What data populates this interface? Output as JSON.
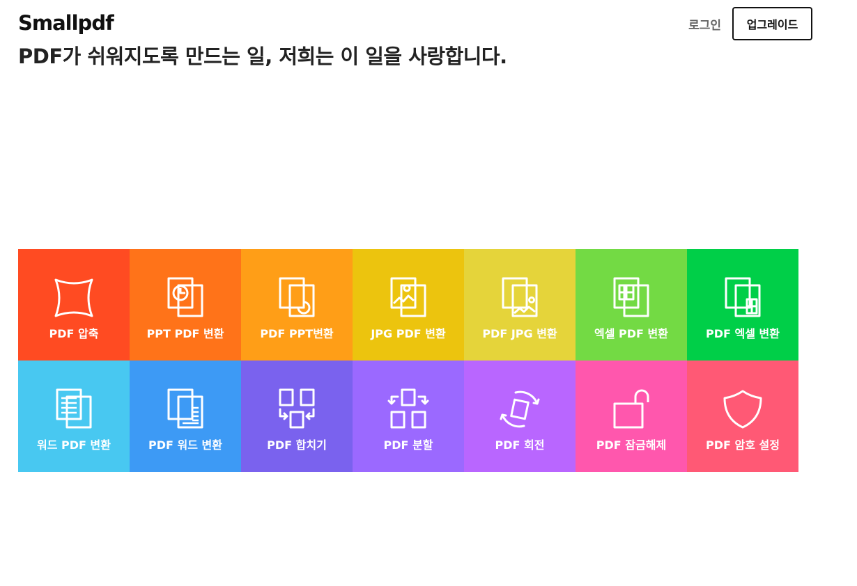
{
  "header": {
    "logo": "Smallpdf",
    "tagline": "PDF가 쉬워지도록 만드는 일, 저희는 이 일을 사랑합니다.",
    "login_label": "로그인",
    "upgrade_label": "업그레이드"
  },
  "tools": [
    {
      "label": "PDF 압축",
      "color": "#ff4b22",
      "icon": "compress-icon"
    },
    {
      "label": "PPT PDF 변환",
      "color": "#ff7319",
      "icon": "ppt-to-pdf-icon"
    },
    {
      "label": "PDF PPT변환",
      "color": "#ff9e17",
      "icon": "pdf-to-ppt-icon"
    },
    {
      "label": "JPG PDF 변환",
      "color": "#ecc40e",
      "icon": "jpg-to-pdf-icon"
    },
    {
      "label": "PDF JPG 변환",
      "color": "#e5d43a",
      "icon": "pdf-to-jpg-icon"
    },
    {
      "label": "엑셀 PDF 변환",
      "color": "#73da44",
      "icon": "excel-to-pdf-icon"
    },
    {
      "label": "PDF 엑셀 변환",
      "color": "#00cf48",
      "icon": "pdf-to-excel-icon"
    },
    {
      "label": "워드 PDF 변환",
      "color": "#48c8f1",
      "icon": "word-to-pdf-icon"
    },
    {
      "label": "PDF 워드 변환",
      "color": "#3d9af5",
      "icon": "pdf-to-word-icon"
    },
    {
      "label": "PDF 합치기",
      "color": "#7a62ee",
      "icon": "merge-icon"
    },
    {
      "label": "PDF 분할",
      "color": "#9b69ff",
      "icon": "split-icon"
    },
    {
      "label": "PDF 회전",
      "color": "#b966ff",
      "icon": "rotate-icon"
    },
    {
      "label": "PDF 잠금해제",
      "color": "#ff57ad",
      "icon": "unlock-icon"
    },
    {
      "label": "PDF 암호 설정",
      "color": "#ff5975",
      "icon": "protect-icon"
    }
  ]
}
